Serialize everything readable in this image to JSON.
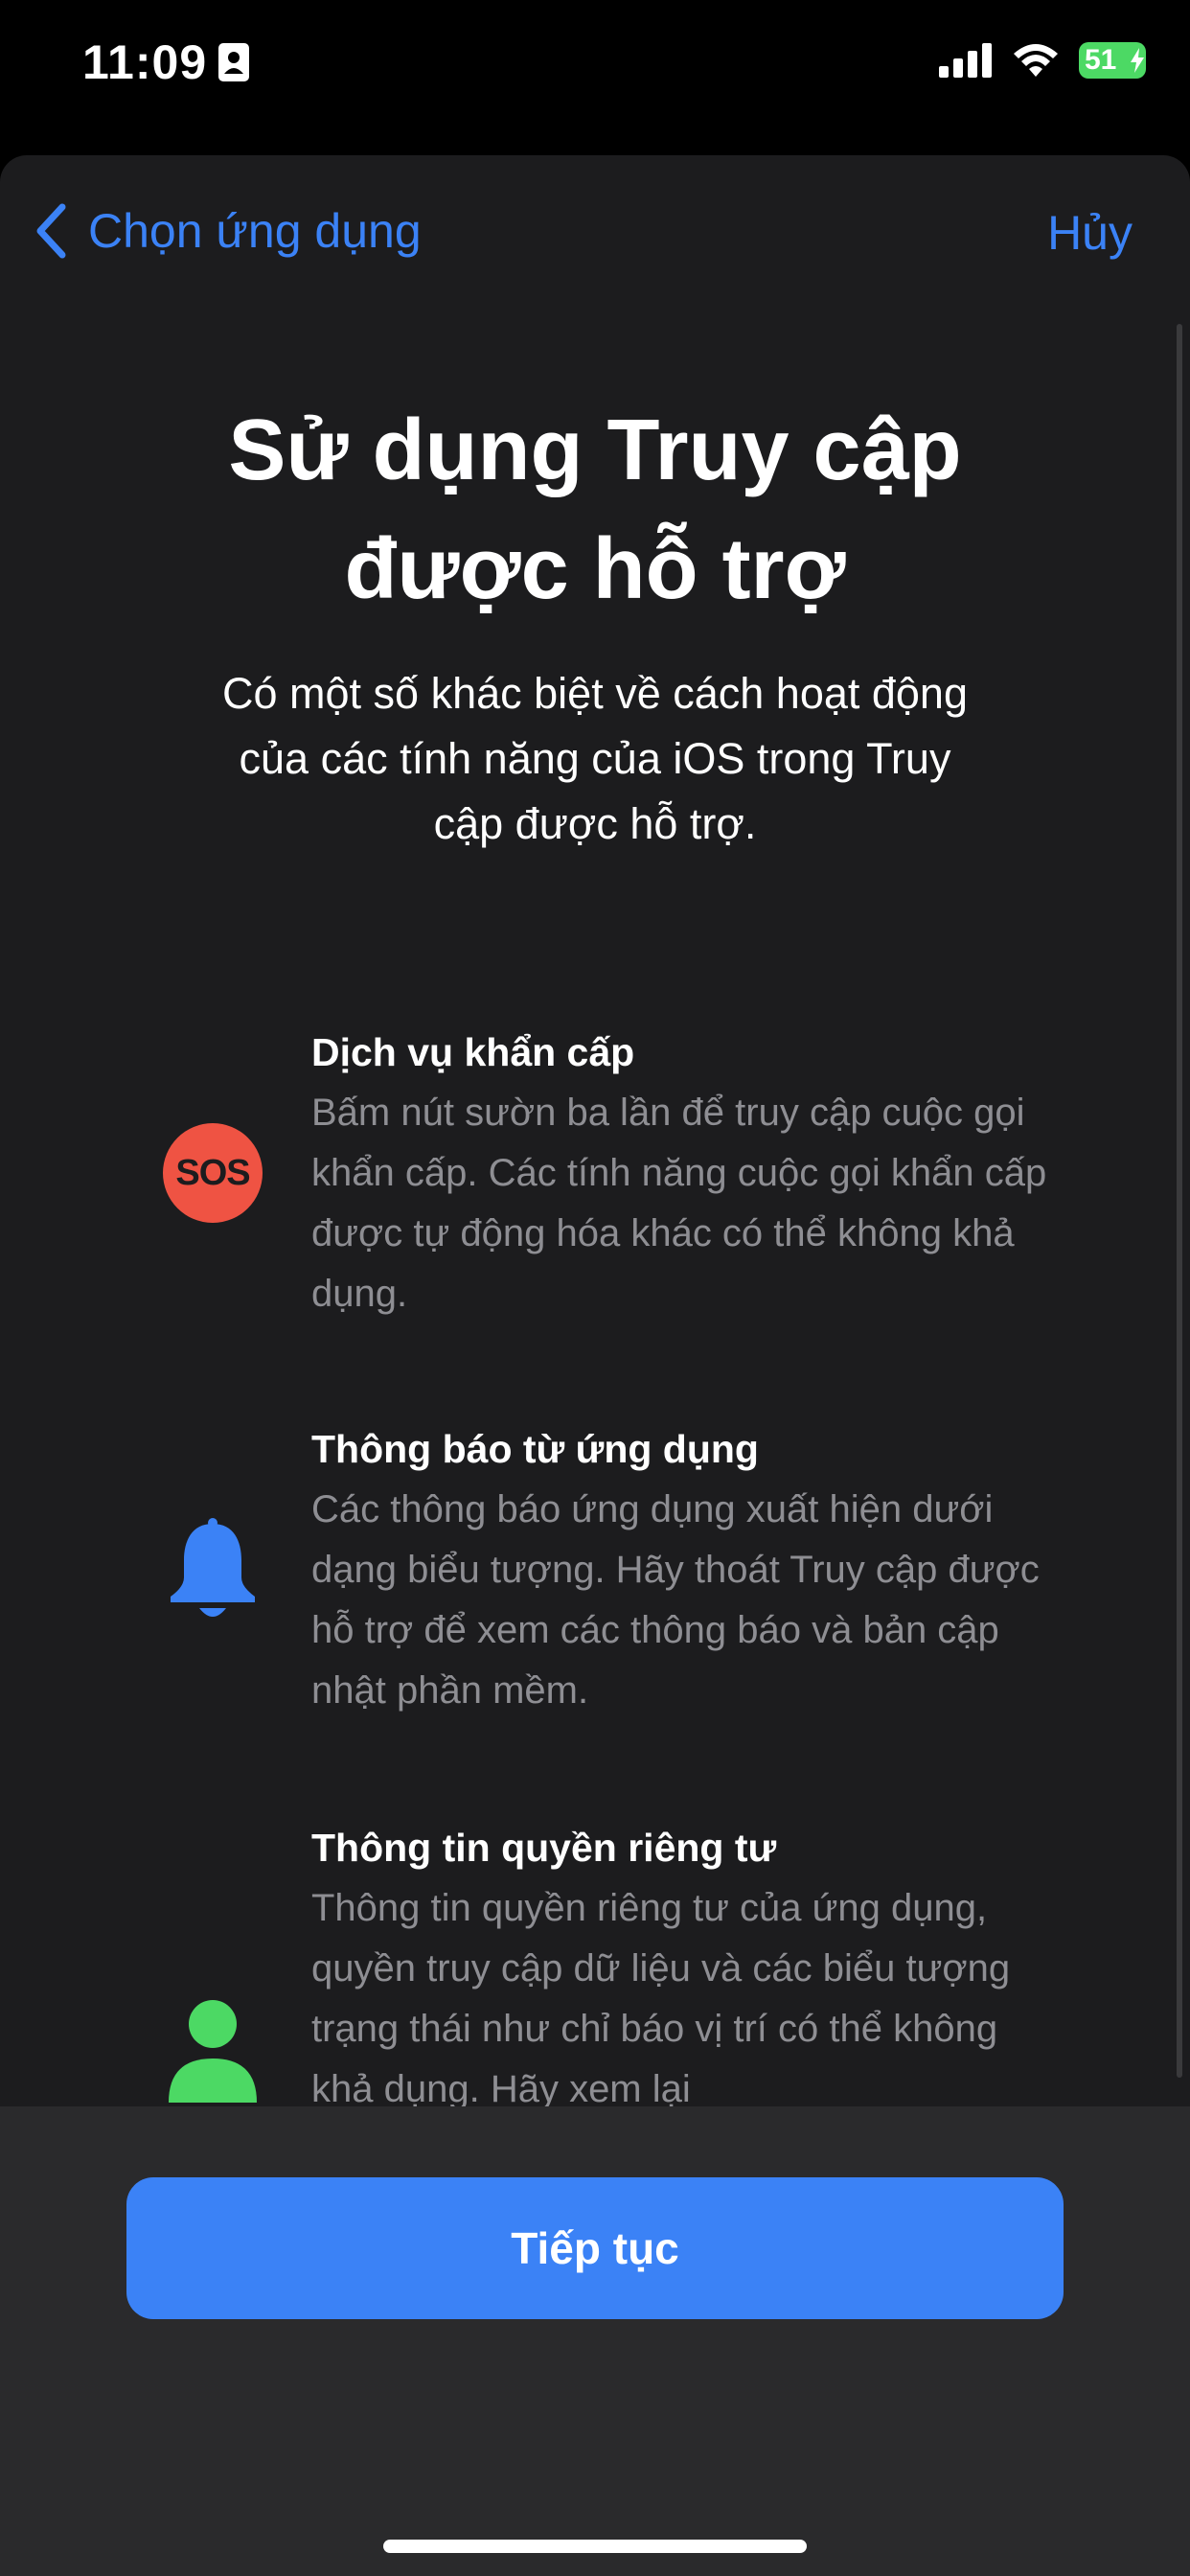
{
  "status_bar": {
    "time": "11:09",
    "battery_level": "51",
    "battery_fraction": 0.51,
    "battery_color": "#4cd964",
    "icons": [
      "person-badge-icon",
      "signal-icon",
      "wifi-icon",
      "battery-icon",
      "bolt-icon"
    ]
  },
  "nav": {
    "back_label": "Chọn ứng dụng",
    "cancel_label": "Hủy",
    "accent_color": "#3b82f6"
  },
  "header": {
    "title_line1": "Sử dụng Truy cập",
    "title_line2": "được hỗ trợ",
    "subtitle": "Có một số khác biệt về cách hoạt động của các tính năng của iOS trong Truy cập được hỗ trợ."
  },
  "features": [
    {
      "icon": "sos-icon",
      "icon_text": "SOS",
      "icon_color": "#ef5343",
      "title": "Dịch vụ khẩn cấp",
      "description": "Bấm nút sườn ba lần để truy cập cuộc gọi khẩn cấp. Các tính năng cuộc gọi khẩn cấp được tự động hóa khác có thể không khả dụng."
    },
    {
      "icon": "bell-icon",
      "icon_color": "#3b82f6",
      "title": "Thông báo từ ứng dụng",
      "description": "Các thông báo ứng dụng xuất hiện dưới dạng biểu tượng. Hãy thoát Truy cập được hỗ trợ để xem các thông báo và bản cập nhật phần mềm."
    },
    {
      "icon": "person-icon",
      "icon_color": "#4cd964",
      "title": "Thông tin quyền riêng tư",
      "description": "Thông tin quyền riêng tư của ứng dụng, quyền truy cập dữ liệu và các biểu tượng trạng thái như chỉ báo vị trí có thể không khả dụng. Hãy xem lại"
    }
  ],
  "footer": {
    "continue_label": "Tiếp tục"
  }
}
